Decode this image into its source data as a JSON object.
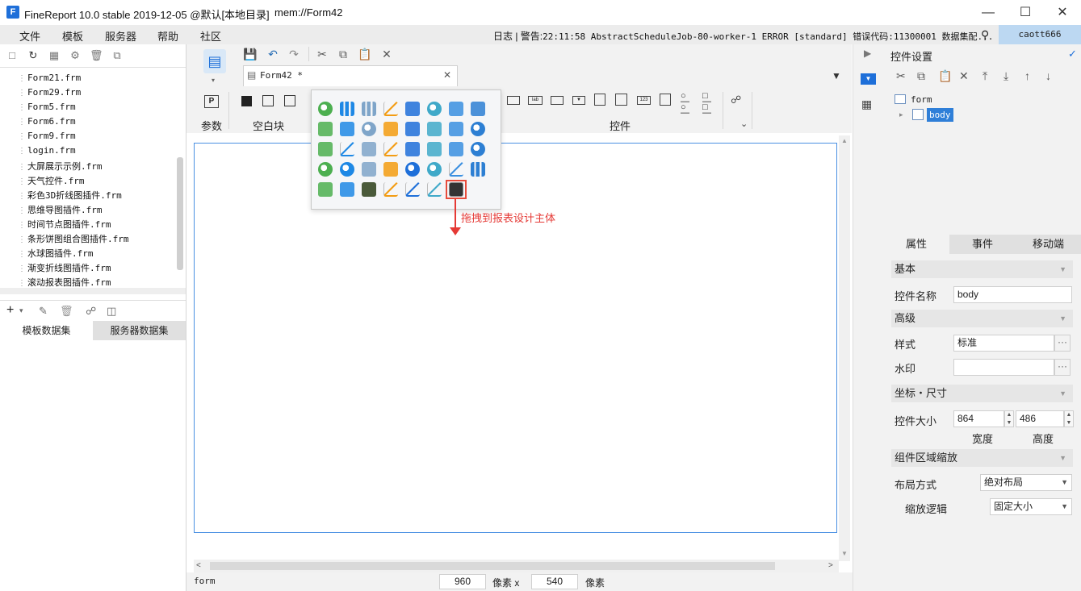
{
  "window": {
    "title": "FineReport 10.0 stable 2019-12-05 @默认[本地目录]",
    "path": "mem://Form42",
    "minimize_icon": "minimize-icon",
    "maximize_icon": "maximize-icon",
    "close_icon": "close-icon"
  },
  "menu": {
    "items": [
      "文件",
      "模板",
      "服务器",
      "帮助",
      "社区"
    ],
    "log_prefix": "日志 | 警告:",
    "log_message": "22:11:58 AbstractScheduleJob-80-worker-1 ERROR [standard] 错误代码:11300001 数据集配...",
    "user": "caott666"
  },
  "left_panel": {
    "files": [
      "Form21.frm",
      "Form29.frm",
      "Form5.frm",
      "Form6.frm",
      "Form9.frm",
      "login.frm",
      "大屏展示示例.frm",
      "天气控件.frm",
      "彩色3D折线图插件.frm",
      "思维导图插件.frm",
      "时间节点图插件.frm",
      "条形饼图组合图插件.frm",
      "水球图插件.frm",
      "渐变折线图插件.frm",
      "滚动报表图插件.frm"
    ],
    "tabs": [
      "模板数据集",
      "服务器数据集"
    ]
  },
  "editor": {
    "tab_label": "Form42 *",
    "sections": {
      "param": "参数",
      "blank": "空白块",
      "controls": "控件"
    },
    "status": {
      "left": "form",
      "width": "960",
      "unit1": "像素 x",
      "height": "540",
      "unit2": "像素"
    }
  },
  "popup": {
    "annotation": "拖拽到报表设计主体"
  },
  "right_panel": {
    "header": "控件设置",
    "tree": {
      "root": "form",
      "child": "body"
    },
    "tabs": [
      "属性",
      "事件",
      "移动端"
    ],
    "basic": {
      "section": "基本",
      "name_label": "控件名称",
      "name_value": "body"
    },
    "advanced": {
      "section": "高级",
      "style_label": "样式",
      "style_value": "标准",
      "watermark_label": "水印",
      "watermark_value": ""
    },
    "coords": {
      "section": "坐标・尺寸",
      "size_label": "控件大小",
      "width_value": "864",
      "height_value": "486",
      "width_label": "宽度",
      "height_label": "高度"
    },
    "scaling": {
      "section": "组件区域缩放",
      "layout_label": "布局方式",
      "layout_value": "绝对布局",
      "logic_label": "缩放逻辑",
      "logic_value": "固定大小"
    }
  },
  "colors": {
    "accent": "#1e6fd9",
    "selection": "#4a90e2",
    "annotation": "#e53935",
    "user_badge": "#bcd8f2"
  }
}
